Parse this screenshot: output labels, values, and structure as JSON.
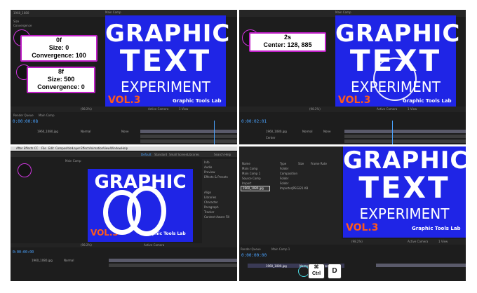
{
  "panel1": {
    "comp_tab": "Main Comp",
    "file_label": "1960_1080",
    "props": [
      "Size",
      "Convergence"
    ],
    "label_a": {
      "time": "0f",
      "line1": "Size: 0",
      "line2": "Convergence: 100"
    },
    "label_b": {
      "time": "8f",
      "line1": "Size: 500",
      "line2": "Convergence: 0"
    },
    "zoom": "(98.2%)",
    "view": "Active Camera",
    "views": "1 View",
    "timecode": "0:00:00:08",
    "render_queue": "Render Queue",
    "layer": "1960_1080.jpg",
    "mode": "Normal",
    "parent": "None"
  },
  "panel2": {
    "comp_tab": "Main Comp",
    "label": {
      "time": "2s",
      "line1": "Center: 128, 885"
    },
    "zoom": "(98.2%)",
    "view": "Active Camera",
    "views": "1 View",
    "timecode": "0:00:02:01",
    "layer": "1960_1080.jpg",
    "mode": "Normal",
    "parent": "None",
    "prop": "Center"
  },
  "panel3": {
    "app_menu": [
      "After Effects CC",
      "File",
      "Edit",
      "Composition",
      "Layer",
      "Effect",
      "Animation",
      "View",
      "Window",
      "Help"
    ],
    "workspaces": [
      "Default",
      "Standard",
      "Small Screen",
      "Libraries"
    ],
    "search": "Search Help",
    "side_panels": [
      "Info",
      "Audio",
      "Preview",
      "Effects & Presets",
      "Align",
      "Libraries",
      "Character",
      "Paragraph",
      "Tracker",
      "Content-Aware Fill"
    ],
    "comp_tab": "Main Comp",
    "zoom": "(98.2%)",
    "view": "Active Camera",
    "timecode": "0:00:00:00",
    "layer": "1960_1080.jpg",
    "mode": "Normal"
  },
  "panel4": {
    "project_cols": [
      "Name",
      "Type",
      "Size",
      "Frame Rate"
    ],
    "items": [
      {
        "name": "Main Comp",
        "type": "Folder"
      },
      {
        "name": "Main Comp 1",
        "type": "Composition"
      },
      {
        "name": "Source Comp",
        "type": "Folder"
      },
      {
        "name": "Import",
        "type": "Folder"
      },
      {
        "name": "1960_1080.jpg",
        "type": "ImporterJPEG",
        "size": "321 KB"
      }
    ],
    "render_queue": "Render Queue",
    "comp_tab": "Main Comp 1",
    "timecode": "0:00:00:00",
    "zoom": "(98.2%)",
    "view": "Active Camera",
    "views": "1 View",
    "layer": "1960_1080.jpg",
    "mode": "Normal",
    "parent": "None",
    "keys": {
      "cmd": "⌘",
      "ctrl": "Ctrl",
      "d": "D"
    }
  },
  "poster": {
    "line1": "GRAPHIC",
    "line2": "TEXT",
    "line3": "EXPERIMENT",
    "vol": "VOL.3",
    "brand": "Graphic Tools Lab",
    "bg_color": "#1f25e6",
    "vol_color": "#ff5a1a"
  }
}
